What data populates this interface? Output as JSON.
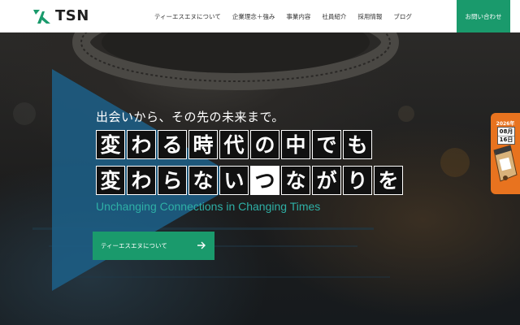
{
  "header": {
    "logo_text": "TSN",
    "nav": [
      {
        "label": "ティーエスエヌについて"
      },
      {
        "label": "企業理念＋強み"
      },
      {
        "label": "事業内容"
      },
      {
        "label": "社員紹介"
      },
      {
        "label": "採用情報"
      },
      {
        "label": "ブログ"
      }
    ],
    "contact_label": "お問い合わせ"
  },
  "hero": {
    "tagline": "出会いから、その先の未来まで。",
    "headline_line1": [
      "変",
      "わ",
      "る",
      "時",
      "代",
      "の",
      "中",
      "で",
      "も"
    ],
    "headline_line2": [
      "変",
      "わ",
      "ら",
      "な",
      "い",
      "つ",
      "な",
      "が",
      "り",
      "を"
    ],
    "headline_line2_inverted_index": 5,
    "subtitle": "Unchanging Connections in Changing Times",
    "cta_label": "ティーエスエヌについて",
    "cta_icon": "arrow-right-icon"
  },
  "side_banner": {
    "year": "2026年",
    "month": "08月",
    "day": "16日"
  },
  "colors": {
    "brand_green": "#1a9a6c",
    "accent_teal": "#2eb0a6",
    "triangle_blue": "#1d5f86",
    "banner_orange": "#e8731f"
  }
}
